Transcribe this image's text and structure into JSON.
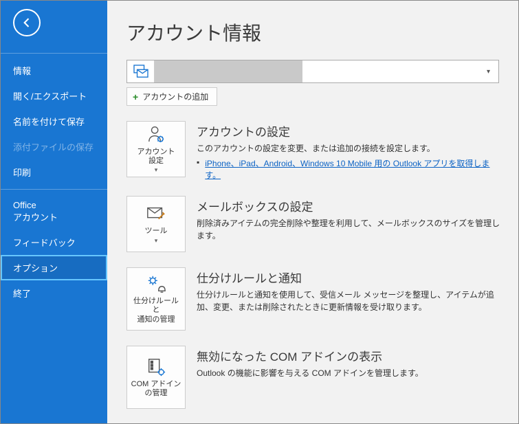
{
  "sidebar": {
    "items": [
      {
        "label": "情報"
      },
      {
        "label": "開く/エクスポート"
      },
      {
        "label": "名前を付けて保存"
      },
      {
        "label": "添付ファイルの保存"
      },
      {
        "label": "印刷"
      },
      {
        "label": "Office\nアカウント"
      },
      {
        "label": "フィードバック"
      },
      {
        "label": "オプション"
      },
      {
        "label": "終了"
      }
    ]
  },
  "page": {
    "title": "アカウント情報",
    "add_account": "アカウントの追加"
  },
  "sections": {
    "account_settings": {
      "tile": "アカウント\n設定",
      "title": "アカウントの設定",
      "desc": "このアカウントの設定を変更、または追加の接続を設定します。",
      "link": "iPhone、iPad、Android、Windows 10 Mobile 用の Outlook アプリを取得します。"
    },
    "mailbox": {
      "tile": "ツール",
      "title": "メールボックスの設定",
      "desc": "削除済みアイテムの完全削除や整理を利用して、メールボックスのサイズを管理します。"
    },
    "rules": {
      "tile": "仕分けルールと\n通知の管理",
      "title": "仕分けルールと通知",
      "desc": "仕分けルールと通知を使用して、受信メール メッセージを整理し、アイテムが追加、変更、または削除されたときに更新情報を受け取ります。"
    },
    "com": {
      "tile": "COM アドイン\nの管理",
      "title": "無効になった COM アドインの表示",
      "desc": "Outlook の機能に影響を与える COM アドインを管理します。"
    }
  }
}
